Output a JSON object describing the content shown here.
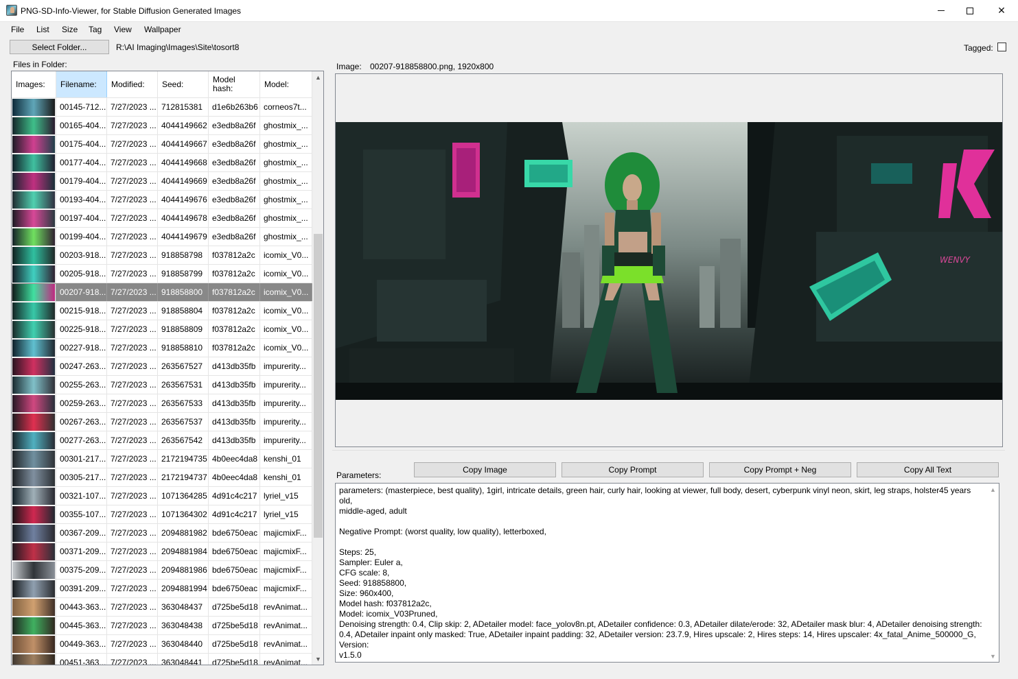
{
  "window": {
    "title": "PNG-SD-Info-Viewer, for Stable Diffusion Generated Images",
    "minimize": "",
    "maximize": "",
    "close": "✕"
  },
  "menu": [
    "File",
    "List",
    "Size",
    "Tag",
    "View",
    "Wallpaper"
  ],
  "toolbar": {
    "select_folder": "Select Folder...",
    "folder_path": "R:\\AI Imaging\\Images\\Site\\tosort8",
    "tagged_label": "Tagged:",
    "tagged_checked": false
  },
  "files_label": "Files in Folder:",
  "columns": [
    "Images:",
    "Filename:",
    "Modified:",
    "Seed:",
    "Model hash:",
    "Model:"
  ],
  "sorted_column": "Filename:",
  "selected_row": 10,
  "rows": [
    {
      "file": "00145-712...",
      "mod": "7/27/2023 ...",
      "seed": "712815381",
      "hash": "d1e6b263b6",
      "model": "corneos7t...",
      "thumb": [
        "#0e2a3a",
        "#5fa6b8",
        "#1a1a1a"
      ]
    },
    {
      "file": "00165-404...",
      "mod": "7/27/2023 ...",
      "seed": "4044149662",
      "hash": "e3edb8a26f",
      "model": "ghostmix_...",
      "thumb": [
        "#15252a",
        "#3fbf8a",
        "#2a1a2e"
      ]
    },
    {
      "file": "00175-404...",
      "mod": "7/27/2023 ...",
      "seed": "4044149667",
      "hash": "e3edb8a26f",
      "model": "ghostmix_...",
      "thumb": [
        "#1c1c26",
        "#d04090",
        "#20404a"
      ]
    },
    {
      "file": "00177-404...",
      "mod": "7/27/2023 ...",
      "seed": "4044149668",
      "hash": "e3edb8a26f",
      "model": "ghostmix_...",
      "thumb": [
        "#102028",
        "#40c0a0",
        "#202030"
      ]
    },
    {
      "file": "00179-404...",
      "mod": "7/27/2023 ...",
      "seed": "4044149669",
      "hash": "e3edb8a26f",
      "model": "ghostmix_...",
      "thumb": [
        "#1a2430",
        "#c03080",
        "#183038"
      ]
    },
    {
      "file": "00193-404...",
      "mod": "7/27/2023 ...",
      "seed": "4044149676",
      "hash": "e3edb8a26f",
      "model": "ghostmix_...",
      "thumb": [
        "#202a30",
        "#50d0b0",
        "#303040"
      ]
    },
    {
      "file": "00197-404...",
      "mod": "7/27/2023 ...",
      "seed": "4044149678",
      "hash": "e3edb8a26f",
      "model": "ghostmix_...",
      "thumb": [
        "#1a1a22",
        "#d84898",
        "#2a3a40"
      ]
    },
    {
      "file": "00199-404...",
      "mod": "7/27/2023 ...",
      "seed": "4044149679",
      "hash": "e3edb8a26f",
      "model": "ghostmix_...",
      "thumb": [
        "#142028",
        "#70e060",
        "#302030"
      ]
    },
    {
      "file": "00203-918...",
      "mod": "7/27/2023 ...",
      "seed": "918858798",
      "hash": "f037812a2c",
      "model": "icomix_V0...",
      "thumb": [
        "#102020",
        "#30c0a0",
        "#202828"
      ]
    },
    {
      "file": "00205-918...",
      "mod": "7/27/2023 ...",
      "seed": "918858799",
      "hash": "f037812a2c",
      "model": "icomix_V0...",
      "thumb": [
        "#141c24",
        "#40d0c0",
        "#302030"
      ]
    },
    {
      "file": "00207-918...",
      "mod": "7/27/2023 ...",
      "seed": "918858800",
      "hash": "f037812a2c",
      "model": "icomix_V0...",
      "thumb": [
        "#0f1a1a",
        "#40e0a0",
        "#c02880"
      ]
    },
    {
      "file": "00215-918...",
      "mod": "7/27/2023 ...",
      "seed": "918858804",
      "hash": "f037812a2c",
      "model": "icomix_V0...",
      "thumb": [
        "#142424",
        "#38c8a8",
        "#202828"
      ]
    },
    {
      "file": "00225-918...",
      "mod": "7/27/2023 ...",
      "seed": "918858809",
      "hash": "f037812a2c",
      "model": "icomix_V0...",
      "thumb": [
        "#182828",
        "#40d0b0",
        "#283030"
      ]
    },
    {
      "file": "00227-918...",
      "mod": "7/27/2023 ...",
      "seed": "918858810",
      "hash": "f037812a2c",
      "model": "icomix_V0...",
      "thumb": [
        "#10202a",
        "#60c0d0",
        "#202830"
      ]
    },
    {
      "file": "00247-263...",
      "mod": "7/27/2023 ...",
      "seed": "263567527",
      "hash": "d413db35fb",
      "model": "impurerity...",
      "thumb": [
        "#281420",
        "#d03060",
        "#203040"
      ]
    },
    {
      "file": "00255-263...",
      "mod": "7/27/2023 ...",
      "seed": "263567531",
      "hash": "d413db35fb",
      "model": "impurerity...",
      "thumb": [
        "#1a2a30",
        "#80c0c8",
        "#303038"
      ]
    },
    {
      "file": "00259-263...",
      "mod": "7/27/2023 ...",
      "seed": "263567533",
      "hash": "d413db35fb",
      "model": "impurerity...",
      "thumb": [
        "#241824",
        "#d04880",
        "#28303a"
      ]
    },
    {
      "file": "00267-263...",
      "mod": "7/27/2023 ...",
      "seed": "263567537",
      "hash": "d413db35fb",
      "model": "impurerity...",
      "thumb": [
        "#1c1c20",
        "#e03050",
        "#303030"
      ]
    },
    {
      "file": "00277-263...",
      "mod": "7/27/2023 ...",
      "seed": "263567542",
      "hash": "d413db35fb",
      "model": "impurerity...",
      "thumb": [
        "#18242a",
        "#50b0c0",
        "#282c34"
      ]
    },
    {
      "file": "00301-217...",
      "mod": "7/27/2023 ...",
      "seed": "2172194735",
      "hash": "4b0eec4da8",
      "model": "kenshi_01",
      "thumb": [
        "#202428",
        "#7090a0",
        "#303438"
      ]
    },
    {
      "file": "00305-217...",
      "mod": "7/27/2023 ...",
      "seed": "2172194737",
      "hash": "4b0eec4da8",
      "model": "kenshi_01",
      "thumb": [
        "#1c2024",
        "#8090a0",
        "#2c3034"
      ]
    },
    {
      "file": "00321-107...",
      "mod": "7/27/2023 ...",
      "seed": "1071364285",
      "hash": "4d91c4c217",
      "model": "lyriel_v15",
      "thumb": [
        "#142028",
        "#a0b0b8",
        "#282830"
      ]
    },
    {
      "file": "00355-107...",
      "mod": "7/27/2023 ...",
      "seed": "1071364302",
      "hash": "4d91c4c217",
      "model": "lyriel_v15",
      "thumb": [
        "#1a1418",
        "#d02850",
        "#202830"
      ]
    },
    {
      "file": "00367-209...",
      "mod": "7/27/2023 ...",
      "seed": "2094881982",
      "hash": "bde6750eac",
      "model": "majicmixF...",
      "thumb": [
        "#181c22",
        "#7080a0",
        "#2a2a30"
      ]
    },
    {
      "file": "00371-209...",
      "mod": "7/27/2023 ...",
      "seed": "2094881984",
      "hash": "bde6750eac",
      "model": "majicmixF...",
      "thumb": [
        "#201820",
        "#c03048",
        "#2a3038"
      ]
    },
    {
      "file": "00375-209...",
      "mod": "7/27/2023 ...",
      "seed": "2094881986",
      "hash": "bde6750eac",
      "model": "majicmixF...",
      "thumb": [
        "#c8ccd0",
        "#303438",
        "#8a9098"
      ]
    },
    {
      "file": "00391-209...",
      "mod": "7/27/2023 ...",
      "seed": "2094881994",
      "hash": "bde6750eac",
      "model": "majicmixF...",
      "thumb": [
        "#181c20",
        "#90a0b0",
        "#2a2c30"
      ]
    },
    {
      "file": "00443-363...",
      "mod": "7/27/2023 ...",
      "seed": "363048437",
      "hash": "d725be5d18",
      "model": "revAnimat...",
      "thumb": [
        "#806040",
        "#d0a070",
        "#403028"
      ]
    },
    {
      "file": "00445-363...",
      "mod": "7/27/2023 ...",
      "seed": "363048438",
      "hash": "d725be5d18",
      "model": "revAnimat...",
      "thumb": [
        "#202820",
        "#40b060",
        "#302820"
      ]
    },
    {
      "file": "00449-363...",
      "mod": "7/27/2023 ...",
      "seed": "363048440",
      "hash": "d725be5d18",
      "model": "revAnimat...",
      "thumb": [
        "#705038",
        "#c09068",
        "#382820"
      ]
    },
    {
      "file": "00451-363...",
      "mod": "7/27/2023 ...",
      "seed": "363048441",
      "hash": "d725be5d18",
      "model": "revAnimat...",
      "thumb": [
        "#403830",
        "#a08060",
        "#302820"
      ]
    }
  ],
  "image_panel": {
    "label": "Image:",
    "info": "00207-918858800.png, 1920x800",
    "sign_text": "WENVY"
  },
  "params": {
    "label": "Parameters:",
    "copy_image": "Copy Image",
    "copy_prompt": "Copy Prompt",
    "copy_prompt_neg": "Copy Prompt + Neg",
    "copy_all": "Copy All Text",
    "text": "parameters: (masterpiece, best quality), 1girl, intricate details, green hair, curly hair, looking at viewer, full body, desert, cyberpunk vinyl neon, skirt, leg straps, holster45 years old,\nmiddle-aged, adult\n\nNegative Prompt: (worst quality, low quality), letterboxed,\n\nSteps: 25,\nSampler: Euler a,\nCFG scale: 8,\nSeed: 918858800,\nSize: 960x400,\nModel hash: f037812a2c,\nModel: icomix_V03Pruned,\nDenoising strength: 0.4, Clip skip: 2, ADetailer model: face_yolov8n.pt, ADetailer confidence: 0.3, ADetailer dilate/erode: 32, ADetailer mask blur: 4, ADetailer denoising strength:\n0.4, ADetailer inpaint only masked: True, ADetailer inpaint padding: 32, ADetailer version: 23.7.9, Hires upscale: 2, Hires steps: 14, Hires upscaler: 4x_fatal_Anime_500000_G, Version:\nv1.5.0"
  },
  "scroll_arrows": {
    "up": "▲",
    "down": "▼"
  },
  "colors": {
    "selection": "#888888",
    "header_sort": "#cce8ff",
    "neon_green": "#40e0a0",
    "neon_pink": "#e0309a"
  }
}
